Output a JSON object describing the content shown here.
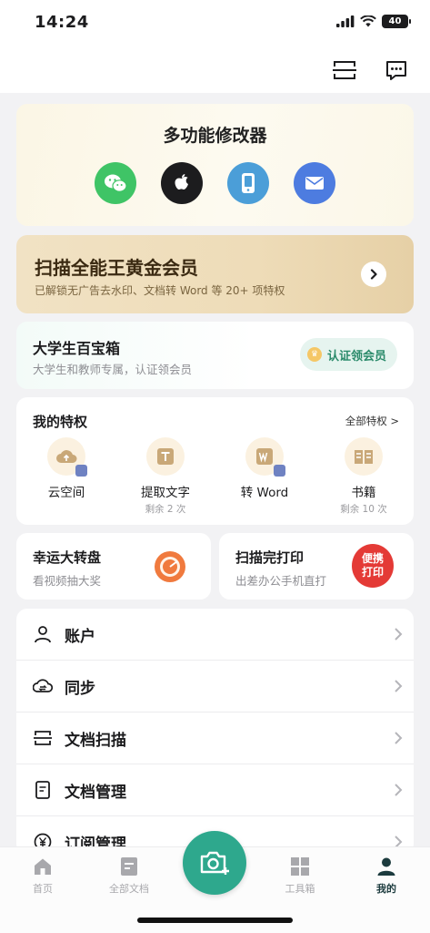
{
  "status_bar": {
    "time": "14:24",
    "battery": "40"
  },
  "tools": {
    "title": "多功能修改器",
    "buttons": [
      {
        "icon": "wechat-icon",
        "color": "#3fc466"
      },
      {
        "icon": "apple-icon",
        "color": "#1c1c1e"
      },
      {
        "icon": "phone-icon",
        "color": "#4b9ed8"
      },
      {
        "icon": "mail-icon",
        "color": "#4d7ce0"
      }
    ]
  },
  "vip": {
    "title": "扫描全能王黄金会员",
    "subtitle": "已解锁无广告去水印、文档转 Word 等 20+ 项特权"
  },
  "student": {
    "title": "大学生百宝箱",
    "subtitle": "大学生和教师专属，认证领会员",
    "button": "认证领会员"
  },
  "privileges": {
    "title": "我的特权",
    "all_link": "全部特权 >",
    "items": [
      {
        "label": "云空间",
        "note": ""
      },
      {
        "label": "提取文字",
        "note": "剩余 2 次"
      },
      {
        "label": "转 Word",
        "note": ""
      },
      {
        "label": "书籍",
        "note": "剩余 10 次"
      }
    ]
  },
  "promos": [
    {
      "title": "幸运大转盘",
      "subtitle": "看视频抽大奖"
    },
    {
      "title": "扫描完打印",
      "subtitle": "出差办公手机直打",
      "badge": "便携\n打印"
    }
  ],
  "menu": [
    {
      "label": "账户",
      "icon": "person-icon"
    },
    {
      "label": "同步",
      "icon": "cloud-sync-icon"
    },
    {
      "label": "文档扫描",
      "icon": "scan-icon"
    },
    {
      "label": "文档管理",
      "icon": "document-icon"
    },
    {
      "label": "订阅管理",
      "icon": "yen-icon"
    }
  ],
  "tabs": [
    {
      "label": "首页",
      "icon": "home-icon"
    },
    {
      "label": "全部文档",
      "icon": "all-docs-icon"
    },
    {
      "label": "工具箱",
      "icon": "grid-icon"
    },
    {
      "label": "我的",
      "icon": "profile-icon",
      "active": true
    }
  ],
  "colors": {
    "accent": "#2ea88d",
    "vip_bg": "#eedcb8"
  }
}
